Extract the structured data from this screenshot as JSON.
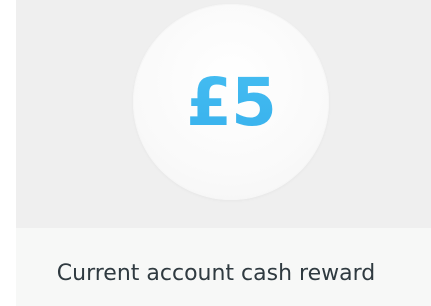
{
  "reward": {
    "amount": "£5",
    "label": "Current account cash reward"
  },
  "colors": {
    "accent": "#34b6ef",
    "hero_background": "#efefef",
    "caption_background": "#f7f8f7",
    "text": "#2f3a40"
  }
}
